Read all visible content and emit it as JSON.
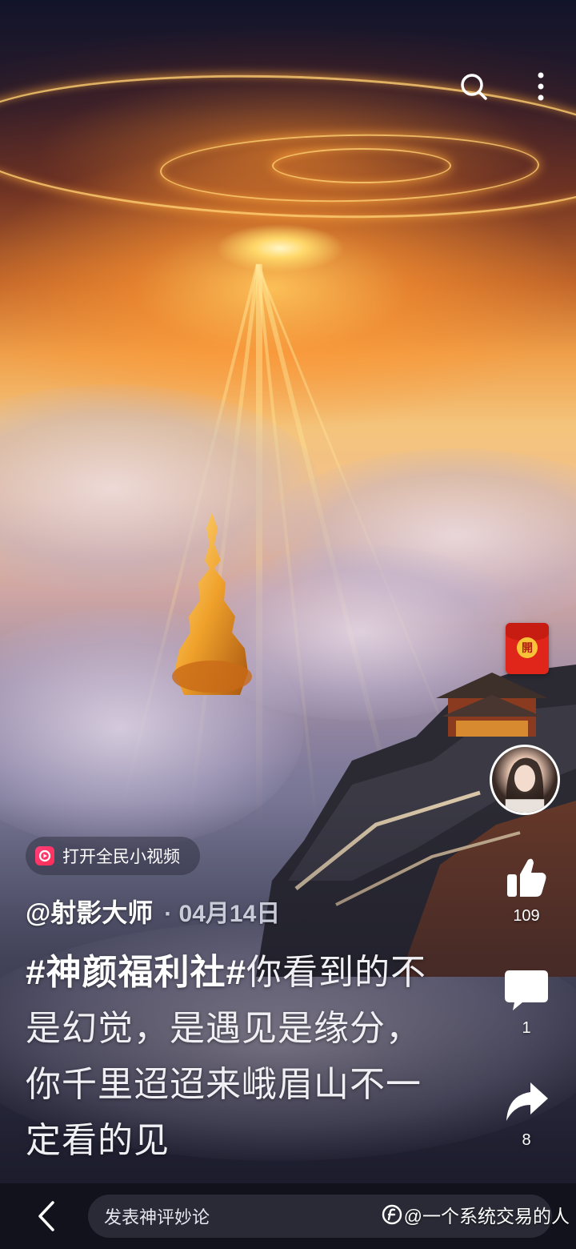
{
  "top_bar": {
    "search_icon": "search-icon",
    "more_icon": "more-vertical-icon"
  },
  "red_packet": {
    "icon": "red-packet-icon",
    "label": "開"
  },
  "actions": {
    "like": {
      "icon": "thumbs-up-icon",
      "count": "109"
    },
    "comment": {
      "icon": "comment-icon",
      "count": "1"
    },
    "share": {
      "icon": "share-arrow-icon",
      "count": "8"
    }
  },
  "app_link": {
    "icon": "quanmin-video-icon",
    "label": "打开全民小视频"
  },
  "post": {
    "author": "@射影大师",
    "date": "· 04月14日",
    "topic": "#神颜福利社#",
    "caption": "你看到的不是幻觉，是遇见是缘分，你千里迢迢来峨眉山不一定看的见"
  },
  "bottom_bar": {
    "back_icon": "chevron-left-icon",
    "comment_placeholder": "发表神评妙论",
    "watermark": "@一个系统交易的人"
  },
  "colors": {
    "accent": "#ff2d55",
    "red_packet": "#e0261a",
    "coin": "#f6c436",
    "bar_bg": "#12121c"
  }
}
